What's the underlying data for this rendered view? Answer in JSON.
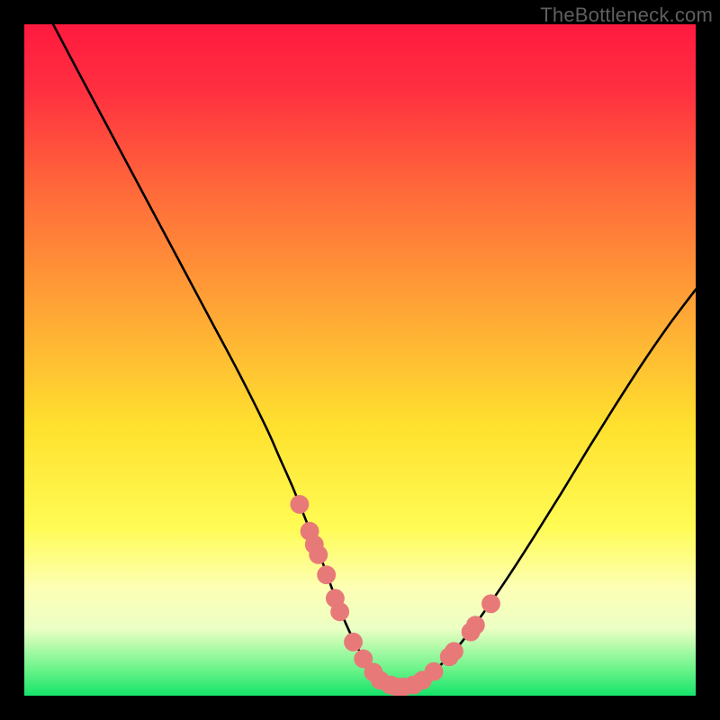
{
  "watermark": "TheBottleneck.com",
  "chart_data": {
    "type": "line",
    "title": "",
    "xlabel": "",
    "ylabel": "",
    "xlim": [
      0,
      100
    ],
    "ylim": [
      0,
      100
    ],
    "background_gradient": {
      "stops": [
        {
          "pos": 0.0,
          "color": "#ff1a3f"
        },
        {
          "pos": 0.1,
          "color": "#ff3040"
        },
        {
          "pos": 0.25,
          "color": "#ff6a3a"
        },
        {
          "pos": 0.45,
          "color": "#ffae35"
        },
        {
          "pos": 0.6,
          "color": "#ffe12e"
        },
        {
          "pos": 0.75,
          "color": "#fffc55"
        },
        {
          "pos": 0.84,
          "color": "#fdffb5"
        },
        {
          "pos": 0.9,
          "color": "#ecffc4"
        },
        {
          "pos": 0.96,
          "color": "#6cf48a"
        },
        {
          "pos": 1.0,
          "color": "#15e36a"
        }
      ]
    },
    "series": [
      {
        "name": "bottleneck-curve",
        "color": "#000000",
        "x": [
          4.3,
          8,
          12,
          16,
          20,
          24,
          28,
          32,
          36,
          38,
          40,
          42,
          44,
          46,
          48,
          50,
          52,
          54,
          56,
          58,
          60,
          64,
          68,
          72,
          76,
          80,
          84,
          88,
          92,
          96,
          100
        ],
        "y": [
          100,
          93,
          85.5,
          78,
          70.5,
          63,
          55.5,
          48,
          40,
          35.5,
          31,
          26,
          21,
          15.5,
          10.5,
          6.5,
          3.5,
          1.8,
          1.2,
          1.5,
          2.8,
          6.6,
          11.8,
          17.6,
          23.8,
          30.2,
          36.8,
          43.2,
          49.4,
          55.2,
          60.5
        ]
      }
    ],
    "marker_points": {
      "name": "highlighted-range",
      "color": "#e77a78",
      "radius": 1.4,
      "points": [
        {
          "x": 41.0,
          "y": 28.5
        },
        {
          "x": 42.5,
          "y": 24.5
        },
        {
          "x": 43.2,
          "y": 22.5
        },
        {
          "x": 43.8,
          "y": 21.0
        },
        {
          "x": 45.0,
          "y": 18.0
        },
        {
          "x": 46.3,
          "y": 14.5
        },
        {
          "x": 47.0,
          "y": 12.5
        },
        {
          "x": 49.0,
          "y": 8.0
        },
        {
          "x": 50.5,
          "y": 5.5
        },
        {
          "x": 52.0,
          "y": 3.5
        },
        {
          "x": 53.0,
          "y": 2.3
        },
        {
          "x": 54.5,
          "y": 1.6
        },
        {
          "x": 55.5,
          "y": 1.3
        },
        {
          "x": 56.5,
          "y": 1.3
        },
        {
          "x": 58.0,
          "y": 1.6
        },
        {
          "x": 59.3,
          "y": 2.3
        },
        {
          "x": 61.0,
          "y": 3.6
        },
        {
          "x": 63.3,
          "y": 5.8
        },
        {
          "x": 64.0,
          "y": 6.6
        },
        {
          "x": 66.5,
          "y": 9.5
        },
        {
          "x": 67.2,
          "y": 10.5
        },
        {
          "x": 69.5,
          "y": 13.7
        }
      ]
    }
  }
}
